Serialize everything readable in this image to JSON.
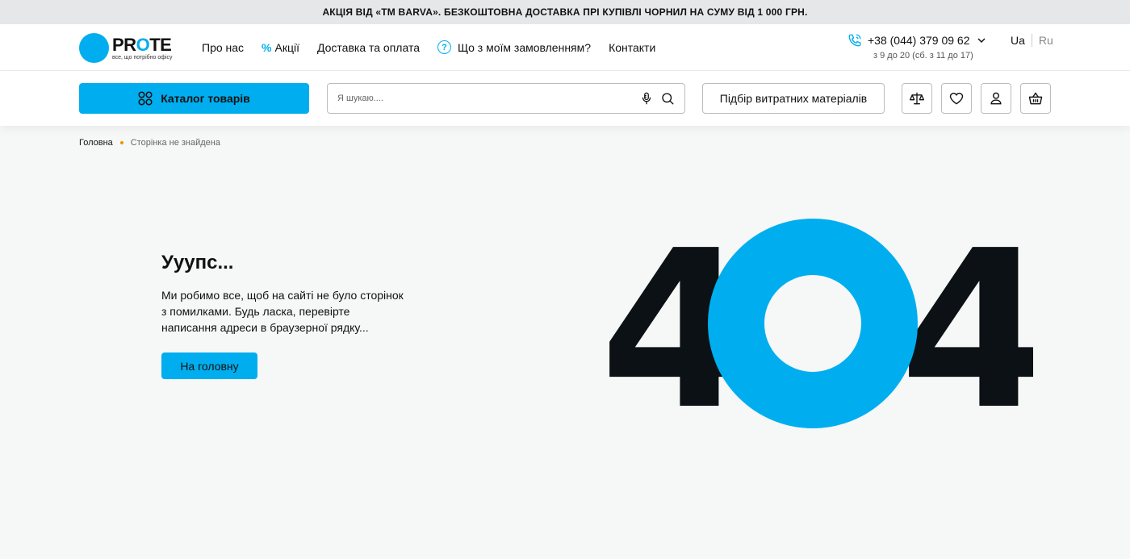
{
  "promo": {
    "text": "АКЦІЯ ВІД «ТМ BARVA». БЕЗКОШТОВНА ДОСТАВКА ПРІ КУПІВЛІ ЧОРНИЛ НА СУМУ ВІД 1 000 ГРН."
  },
  "logo": {
    "word_start": "PR",
    "word_o": "O",
    "word_end": "TE",
    "tagline": "все, що потрібно офісу"
  },
  "nav": {
    "about": "Про нас",
    "promo_mark": "%",
    "promos": "Акції",
    "delivery": "Доставка та оплата",
    "order_status_icon": "?",
    "order_status": "Що з моїм замовленням?",
    "contacts": "Контакти"
  },
  "contact": {
    "phone": "+38 (044) 379 09 62",
    "hours": "з 9 до 20 (сб. з 11 до 17)"
  },
  "lang": {
    "ua": "Ua",
    "ru": "Ru"
  },
  "toolbar": {
    "catalog_label": "Каталог товарів",
    "search_placeholder": "Я шукаю....",
    "picker_label": "Підбір витратних матеріалів"
  },
  "breadcrumb": {
    "home": "Головна",
    "current": "Сторінка не знайдена"
  },
  "error": {
    "title": "Ууупс...",
    "description": "Ми робимо все, щоб на сайті не було сторінок з помилками. Будь ласка, перевірте написання адреси в браузерної рядку...",
    "home_button": "На головну",
    "code_left": "4",
    "code_right": "4"
  },
  "colors": {
    "accent": "#00aeef",
    "dark": "#0b1114",
    "promo_bg": "#e6e7e8",
    "breadcrumb_dot": "#f39200",
    "page_bg": "#f6f7f7"
  },
  "icons": [
    "phone-icon",
    "chevron-down-icon",
    "question-icon",
    "grid-icon",
    "microphone-icon",
    "search-icon",
    "compare-scales-icon",
    "heart-icon",
    "user-icon",
    "cart-icon"
  ]
}
